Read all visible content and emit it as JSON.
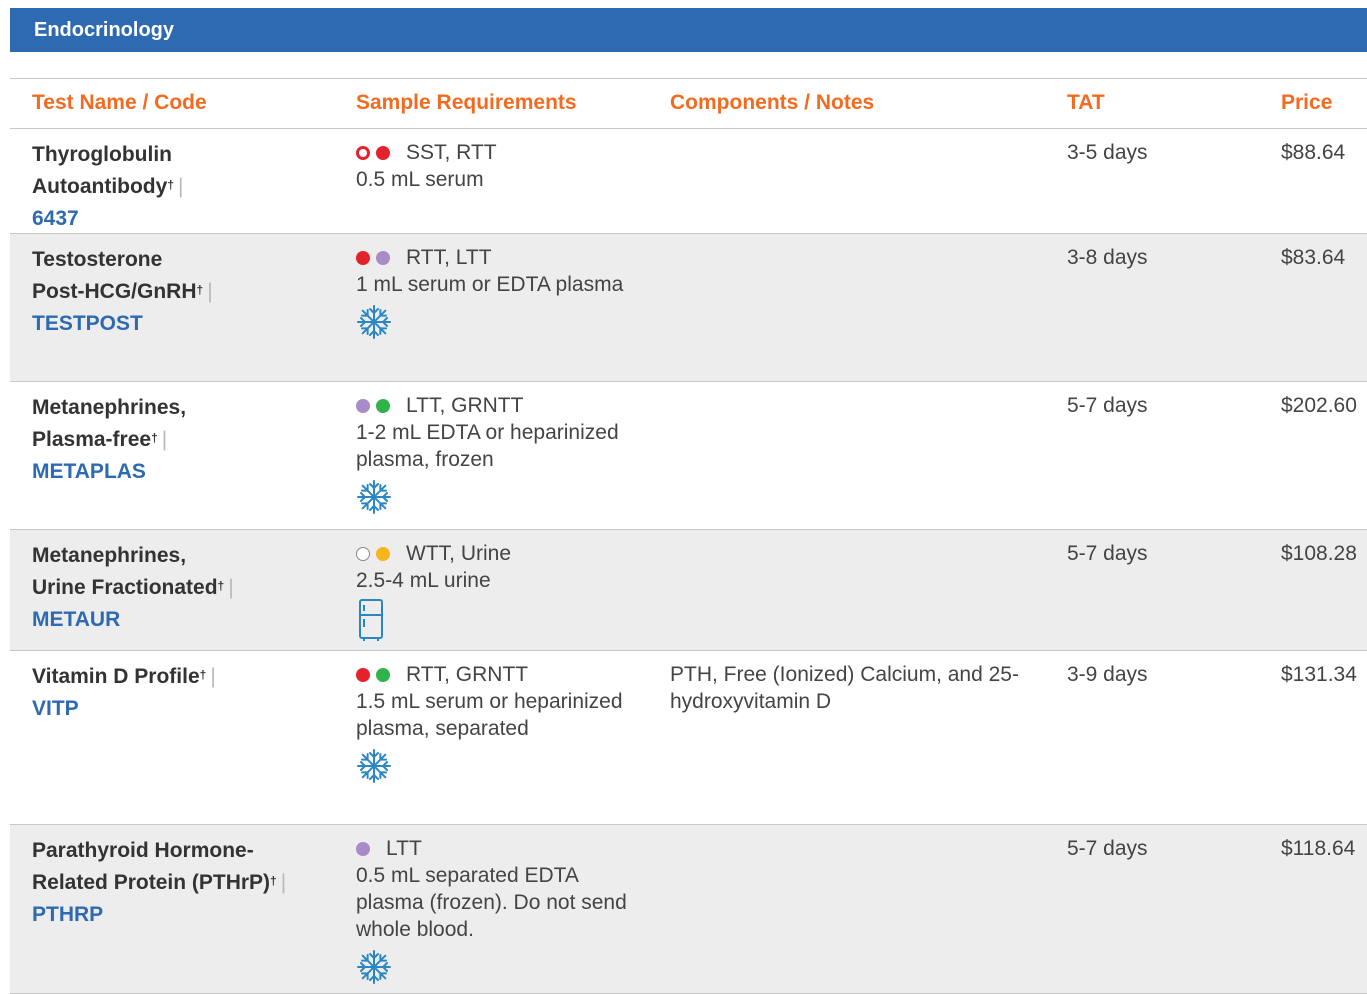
{
  "section": {
    "title": "Endocrinology"
  },
  "headers": {
    "name": "Test Name / Code",
    "sample": "Sample Requirements",
    "components": "Components / Notes",
    "tat": "TAT",
    "price": "Price"
  },
  "colors": {
    "header_bg": "#2d6ab1",
    "header_text": "#f36b21",
    "code_link": "#2d6ab1",
    "row_shade": "#ededed",
    "tube_red": "#e3222b",
    "tube_lavender": "#a98bc8",
    "tube_green": "#2fb34a",
    "tube_yellow": "#f6b51b",
    "tube_white_outline": "#888888",
    "icon_blue": "#2a87c4"
  },
  "rows": [
    {
      "name_lines": [
        "Thyroglobulin",
        "Autoantibody"
      ],
      "dagger": "†",
      "pipe": "|",
      "code": "6437",
      "tubes": [
        "sst-red-outline",
        "red"
      ],
      "tube_label": "SST, RTT",
      "detail": "0.5 mL serum",
      "components": "",
      "tat": "3-5 days",
      "price": "$88.64",
      "storage_icon": ""
    },
    {
      "name_lines": [
        "Testosterone",
        "Post-HCG/GnRH"
      ],
      "dagger": "†",
      "pipe": "|",
      "code": "TESTPOST",
      "tubes": [
        "red",
        "lavender"
      ],
      "tube_label": "RTT, LTT",
      "detail": "1 mL serum or EDTA plasma",
      "components": "",
      "tat": "3-8 days",
      "price": "$83.64",
      "storage_icon": "snowflake-icon"
    },
    {
      "name_lines": [
        "Metanephrines,",
        "Plasma-free"
      ],
      "dagger": "†",
      "pipe": "|",
      "code": "METAPLAS",
      "tubes": [
        "lavender",
        "green"
      ],
      "tube_label": "LTT, GRNTT",
      "detail": "1-2 mL EDTA or heparinized plasma, frozen",
      "components": "",
      "tat": "5-7 days",
      "price": "$202.60",
      "storage_icon": "snowflake-icon"
    },
    {
      "name_lines": [
        "Metanephrines,",
        "Urine Fractionated"
      ],
      "dagger": "†",
      "pipe": "|",
      "code": "METAUR",
      "tubes": [
        "white-outline",
        "yellow"
      ],
      "tube_label": "WTT, Urine",
      "detail": "2.5-4 mL urine",
      "components": "",
      "tat": "5-7 days",
      "price": "$108.28",
      "storage_icon": "refrigerator-icon"
    },
    {
      "name_lines": [
        "Vitamin D Profile"
      ],
      "dagger": "†",
      "pipe": "|",
      "code": "VITP",
      "tubes": [
        "red",
        "green"
      ],
      "tube_label": "RTT, GRNTT",
      "detail": "1.5 mL serum or heparinized plasma, separated",
      "components": "PTH, Free (Ionized) Calcium, and 25-hydroxyvitamin D",
      "tat": "3-9 days",
      "price": "$131.34",
      "storage_icon": "snowflake-icon"
    },
    {
      "name_lines": [
        "Parathyroid Hormone-",
        "Related Protein (PTHrP)"
      ],
      "dagger": "†",
      "pipe": "|",
      "code": "PTHRP",
      "tubes": [
        "lavender"
      ],
      "tube_label": "LTT",
      "detail": "0.5 mL separated EDTA plasma (frozen). Do not send whole blood.",
      "components": "",
      "tat": "5-7 days",
      "price": "$118.64",
      "storage_icon": "snowflake-icon"
    }
  ]
}
